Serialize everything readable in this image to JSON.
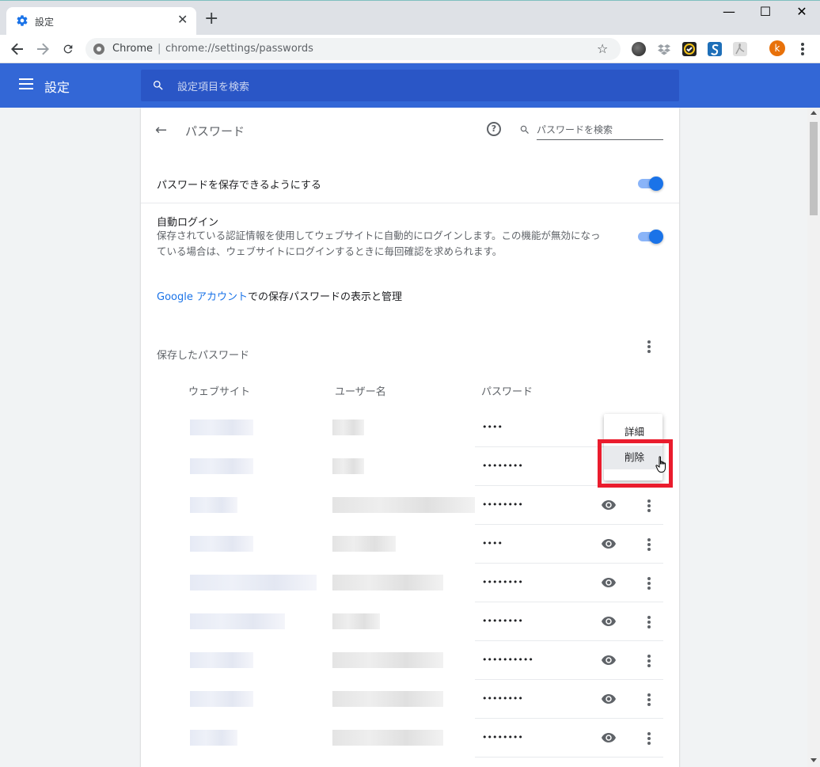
{
  "browser": {
    "tab_title": "設定",
    "omnibox_site": "Chrome",
    "omnibox_sep": "|",
    "omnibox_url": "chrome://settings/passwords",
    "avatar_letter": "k",
    "icons": [
      "gear-icon",
      "close-icon",
      "plus-icon",
      "back-icon",
      "forward-icon",
      "reload-icon",
      "star-icon",
      "kebab-icon"
    ]
  },
  "appbar": {
    "title": "設定",
    "search_placeholder": "設定項目を検索"
  },
  "page": {
    "title": "パスワード",
    "search_placeholder": "パスワードを検索",
    "offer_to_save_label": "パスワードを保存できるようにする",
    "offer_to_save_on": true,
    "auto_signin_label": "自動ログイン",
    "auto_signin_desc_line1": "保存されている認証情報を使用してウェブサイトに自動的にログインします。この機能が無効になっ",
    "auto_signin_desc_line2": "ている場合は、ウェブサイトにログインするときに毎回確認を求められます。",
    "auto_signin_on": true,
    "manage_link_google": "Google アカウント",
    "manage_link_rest": "での保存パスワードの表示と管理",
    "saved_passwords_heading": "保存したパスワード",
    "col_website": "ウェブサイト",
    "col_username": "ユーザー名",
    "col_password": "パスワード"
  },
  "rows": [
    {
      "password": "••••"
    },
    {
      "password": "••••••••"
    },
    {
      "password": "••••••••"
    },
    {
      "password": "••••"
    },
    {
      "password": "••••••••"
    },
    {
      "password": "••••••••"
    },
    {
      "password": "••••••••••"
    },
    {
      "password": "••••••••"
    },
    {
      "password": "••••••••"
    }
  ],
  "menu": {
    "details": "詳細",
    "remove": "削除"
  },
  "colors": {
    "accent": "#3367d6",
    "toggle": "#1a73e8",
    "highlight_box": "#ea1c2d"
  }
}
